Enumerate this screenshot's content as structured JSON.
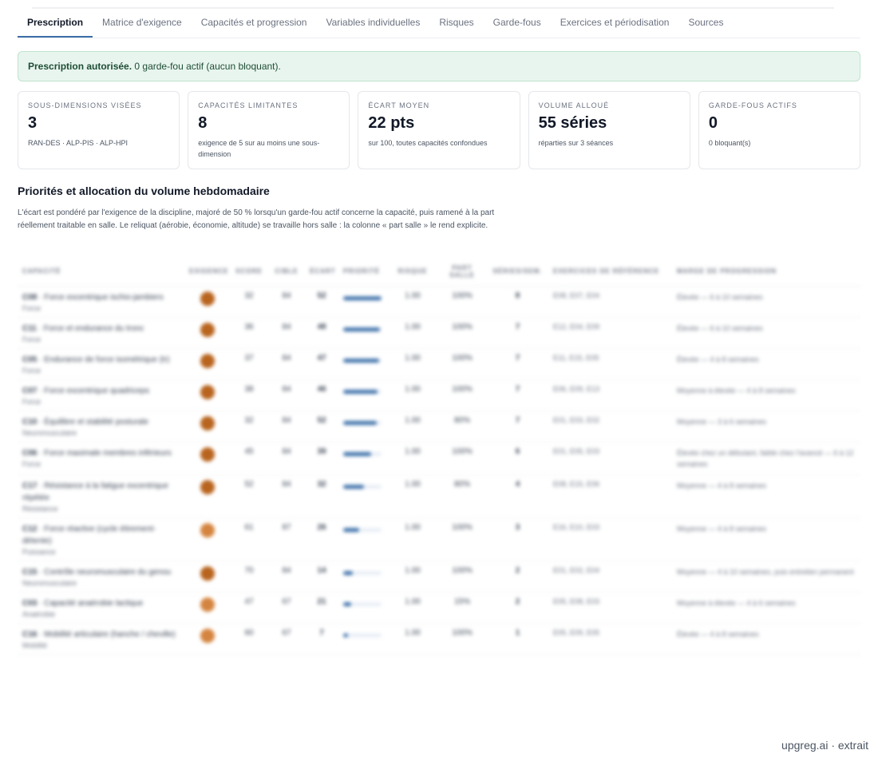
{
  "tabs": [
    {
      "label": "Prescription",
      "active": true
    },
    {
      "label": "Matrice d'exigence",
      "active": false
    },
    {
      "label": "Capacités et progression",
      "active": false
    },
    {
      "label": "Variables individuelles",
      "active": false
    },
    {
      "label": "Risques",
      "active": false
    },
    {
      "label": "Garde-fous",
      "active": false
    },
    {
      "label": "Exercices et périodisation",
      "active": false
    },
    {
      "label": "Sources",
      "active": false
    }
  ],
  "alert": {
    "strong": "Prescription autorisée.",
    "text": " 0 garde-fou actif (aucun bloquant)."
  },
  "cards": [
    {
      "label": "Sous-dimensions visées",
      "value": "3",
      "sub": "RAN-DES · ALP-PIS · ALP-HPI"
    },
    {
      "label": "Capacités limitantes",
      "value": "8",
      "sub": "exigence de 5 sur au moins une sous-dimension"
    },
    {
      "label": "Écart moyen",
      "value": "22 pts",
      "sub": "sur 100, toutes capacités confondues"
    },
    {
      "label": "Volume alloué",
      "value": "55 séries",
      "sub": "réparties sur 3 séances"
    },
    {
      "label": "Garde-fous actifs",
      "value": "0",
      "sub": "0 bloquant(s)"
    }
  ],
  "section": {
    "title": "Priorités et allocation du volume hebdomadaire",
    "description": "L'écart est pondéré par l'exigence de la discipline, majoré de 50 % lorsqu'un garde-fou actif concerne la capacité, puis ramené à la part réellement traitable en salle. Le reliquat (aérobie, économie, altitude) se travaille hors salle : la colonne « part salle » le rend explicite."
  },
  "table": {
    "headers": [
      "Capacité",
      "Exigence",
      "Score",
      "Cible",
      "Écart",
      "Priorité",
      "Risque",
      "Part salle",
      "Séries/sem.",
      "Exercices de référence",
      "Marge de progression"
    ],
    "rows": [
      {
        "code": "C08",
        "name": "Force excentrique ischio-jambiers",
        "cat": "Force",
        "dot": "#b8641e",
        "score": "32",
        "cible": "84",
        "ecart": "52",
        "prio": 1.0,
        "risque": "1.00",
        "part": "100%",
        "series": "8",
        "ex": "E08, E07, E04",
        "marge": "Élevée — 6 à 10 semaines"
      },
      {
        "code": "C11",
        "name": "Force et endurance du tronc",
        "cat": "Force",
        "dot": "#b8641e",
        "score": "36",
        "cible": "84",
        "ecart": "48",
        "prio": 0.95,
        "risque": "1.00",
        "part": "100%",
        "series": "7",
        "ex": "E12, E04, E09",
        "marge": "Élevée — 6 à 10 semaines"
      },
      {
        "code": "C05",
        "name": "Endurance de force isométrique (tr)",
        "cat": "Force",
        "dot": "#b8641e",
        "score": "37",
        "cible": "84",
        "ecart": "47",
        "prio": 0.93,
        "risque": "1.00",
        "part": "100%",
        "series": "7",
        "ex": "E11, E15, E05",
        "marge": "Élevée — 4 à 8 semaines"
      },
      {
        "code": "C07",
        "name": "Force excentrique quadriceps",
        "cat": "Force",
        "dot": "#b8641e",
        "score": "38",
        "cible": "84",
        "ecart": "46",
        "prio": 0.9,
        "risque": "1.00",
        "part": "100%",
        "series": "7",
        "ex": "E06, E09, E13",
        "marge": "Moyenne à élevée — 4 à 8 semaines"
      },
      {
        "code": "C10",
        "name": "Équilibre et stabilité posturale",
        "cat": "Neuromusculaire",
        "dot": "#b8641e",
        "score": "32",
        "cible": "84",
        "ecart": "52",
        "prio": 0.88,
        "risque": "1.00",
        "part": "80%",
        "series": "7",
        "ex": "E01, E03, E02",
        "marge": "Moyenne — 3 à 6 semaines"
      },
      {
        "code": "C06",
        "name": "Force maximale membres inférieurs",
        "cat": "Force",
        "dot": "#b8641e",
        "score": "45",
        "cible": "84",
        "ecart": "39",
        "prio": 0.72,
        "risque": "1.00",
        "part": "100%",
        "series": "6",
        "ex": "E01, E05, E03",
        "marge": "Élevée chez un débutant, faible chez l'avancé — 6 à 12 semaines"
      },
      {
        "code": "C17",
        "name": "Résistance à la fatigue excentrique répétée",
        "cat": "Résistance",
        "dot": "#b8641e",
        "score": "52",
        "cible": "84",
        "ecart": "32",
        "prio": 0.55,
        "risque": "1.00",
        "part": "80%",
        "series": "4",
        "ex": "E08, E15, E06",
        "marge": "Moyenne — 4 à 8 semaines"
      },
      {
        "code": "C12",
        "name": "Force réactive (cycle étirement-détente)",
        "cat": "Puissance",
        "dot": "#d4843f",
        "score": "61",
        "cible": "87",
        "ecart": "26",
        "prio": 0.42,
        "risque": "1.00",
        "part": "100%",
        "series": "3",
        "ex": "E16, E10, E03",
        "marge": "Moyenne — 4 à 8 semaines"
      },
      {
        "code": "C15",
        "name": "Contrôle neuromusculaire du genou",
        "cat": "Neuromusculaire",
        "dot": "#b8641e",
        "score": "70",
        "cible": "84",
        "ecart": "14",
        "prio": 0.25,
        "risque": "1.00",
        "part": "100%",
        "series": "2",
        "ex": "E01, E02, E04",
        "marge": "Moyenne — 4 à 10 semaines, puis entretien permanent"
      },
      {
        "code": "C03",
        "name": "Capacité anaérobie lactique",
        "cat": "Anaérobie",
        "dot": "#d4843f",
        "score": "47",
        "cible": "67",
        "ecart": "21",
        "prio": 0.2,
        "risque": "1.00",
        "part": "15%",
        "series": "2",
        "ex": "E05, E08, E03",
        "marge": "Moyenne à élevée — 4 à 6 semaines"
      },
      {
        "code": "C16",
        "name": "Mobilité articulaire (hanche / cheville)",
        "cat": "Mobilité",
        "dot": "#d4843f",
        "score": "60",
        "cible": "67",
        "ecart": "7",
        "prio": 0.12,
        "risque": "1.00",
        "part": "100%",
        "series": "1",
        "ex": "E05, E09, E05",
        "marge": "Élevée — 4 à 8 semaines"
      }
    ]
  },
  "watermark": "upgreg.ai · extrait"
}
